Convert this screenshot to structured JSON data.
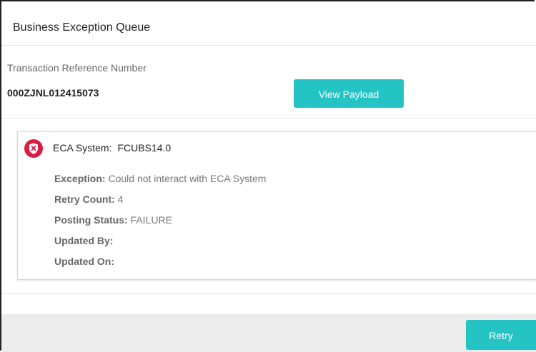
{
  "header": {
    "title": "Business Exception Queue"
  },
  "transaction": {
    "label": "Transaction Reference Number",
    "value": "000ZJNL012415073"
  },
  "buttons": {
    "view_payload": "View Payload",
    "retry": "Retry"
  },
  "exception_card": {
    "system_label": "ECA System:",
    "system_value": "FCUBS14.0",
    "status_icon": "error-shield-icon",
    "fields": [
      {
        "label": "Exception:",
        "value": "Could not interact with ECA System"
      },
      {
        "label": "Retry Count:",
        "value": "4"
      },
      {
        "label": "Posting Status:",
        "value": "FAILURE"
      },
      {
        "label": "Updated By:",
        "value": ""
      },
      {
        "label": "Updated On:",
        "value": ""
      }
    ]
  },
  "colors": {
    "accent": "#24c4c4",
    "error": "#d81e43",
    "footer_bg": "#ececec"
  }
}
